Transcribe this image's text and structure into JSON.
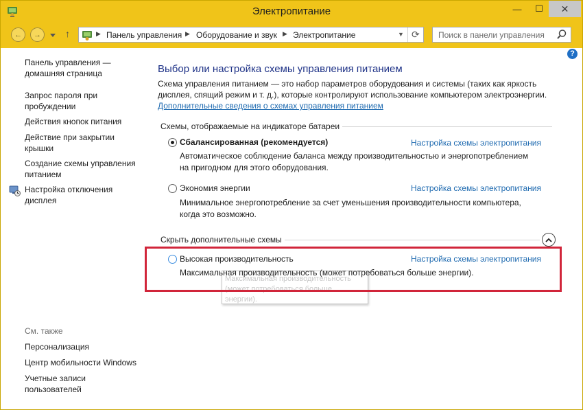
{
  "window": {
    "title": "Электропитание",
    "controls": {
      "minimize": "—",
      "maximize": "☐",
      "close": "✕"
    }
  },
  "navigation": {
    "back": "←",
    "forward": "→",
    "up": "↑",
    "breadcrumbs": [
      "Панель управления",
      "Оборудование и звук",
      "Электропитание"
    ],
    "refresh": "⟳",
    "search_placeholder": "Поиск в панели управления"
  },
  "help": {
    "label": "?"
  },
  "sidebar": {
    "home_link": [
      "Панель управления —",
      "домашняя страница"
    ],
    "links": [
      [
        "Запрос пароля при",
        "пробуждении"
      ],
      [
        "Действия кнопок питания"
      ],
      [
        "Действие при закрытии",
        "крышки"
      ],
      [
        "Создание схемы управления",
        "питанием"
      ],
      [
        "Настройка отключения",
        "дисплея"
      ]
    ],
    "see_also_title": "См. также",
    "see_also_links": [
      [
        "Персонализация"
      ],
      [
        "Центр мобильности Windows"
      ],
      [
        "Учетные записи",
        "пользователей"
      ]
    ]
  },
  "main": {
    "title": "Выбор или настройка схемы управления питанием",
    "intro": "Схема управления питанием — это набор параметров оборудования и системы (таких как яркость дисплея, спящий режим и т. д.), которые контролируют использование компьютером электроэнергии.",
    "intro_link": "Дополнительные сведения о схемах управления питанием",
    "battery_group_title": "Схемы, отображаемые на индикаторе батареи",
    "extra_group_title": "Скрыть дополнительные схемы",
    "plan_settings_link": "Настройка схемы электропитания",
    "plans": [
      {
        "name": "Сбалансированная (рекомендуется)",
        "desc": [
          "Автоматическое соблюдение баланса между производительностью и энергопотреблением",
          "на пригодном для этого оборудования."
        ],
        "selected": true
      },
      {
        "name": "Экономия энергии",
        "desc": [
          "Минимальное энергопотребление за счет уменьшения производительности компьютера,",
          "когда это возможно."
        ],
        "selected": false
      },
      {
        "name": "Высокая производительность",
        "desc": [
          "Максимальная производительность (может потребоваться больше энергии)."
        ],
        "selected": false
      }
    ],
    "tooltip": [
      "Максимальная производительность",
      "(может потребоваться больше",
      "энергии)."
    ]
  },
  "colors": {
    "titlebar": "#f0c419",
    "heading": "#1e3287",
    "link": "#1e6ab0",
    "highlight": "#d1253a"
  }
}
